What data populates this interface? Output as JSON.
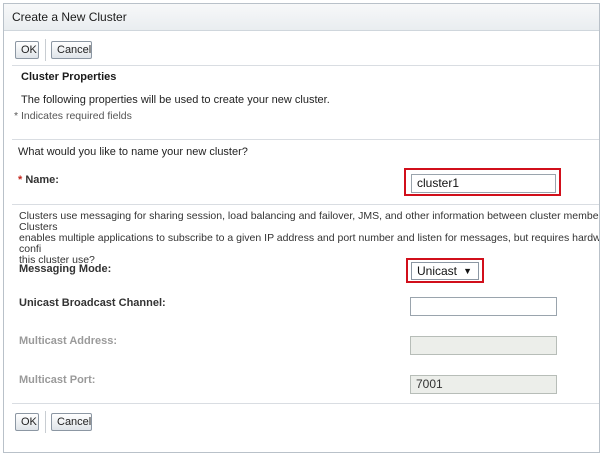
{
  "dialog": {
    "title": "Create a New Cluster"
  },
  "buttons": {
    "ok": "OK",
    "cancel": "Cancel"
  },
  "section": {
    "heading": "Cluster Properties",
    "intro": "The following properties will be used to create your new cluster.",
    "required_note": "* Indicates required fields"
  },
  "question": "What would you like to name your new cluster?",
  "name_field": {
    "required_marker": "*",
    "label": "Name:",
    "value": "cluster1"
  },
  "description": {
    "line1": "Clusters use messaging for sharing session, load balancing and failover, JMS, and other information between cluster members. Clusters",
    "line2": "enables multiple applications to subscribe to a given IP address and port number and listen for messages, but requires hardware confi",
    "line3": "this cluster use?"
  },
  "messaging_mode": {
    "label": "Messaging Mode:",
    "selected": "Unicast"
  },
  "unicast_channel": {
    "label": "Unicast Broadcast Channel:",
    "value": ""
  },
  "multicast_address": {
    "label": "Multicast Address:",
    "value": ""
  },
  "multicast_port": {
    "label": "Multicast Port:",
    "value": "7001"
  },
  "colors": {
    "highlight": "#d10f1b",
    "required_star": "#c4261d"
  }
}
